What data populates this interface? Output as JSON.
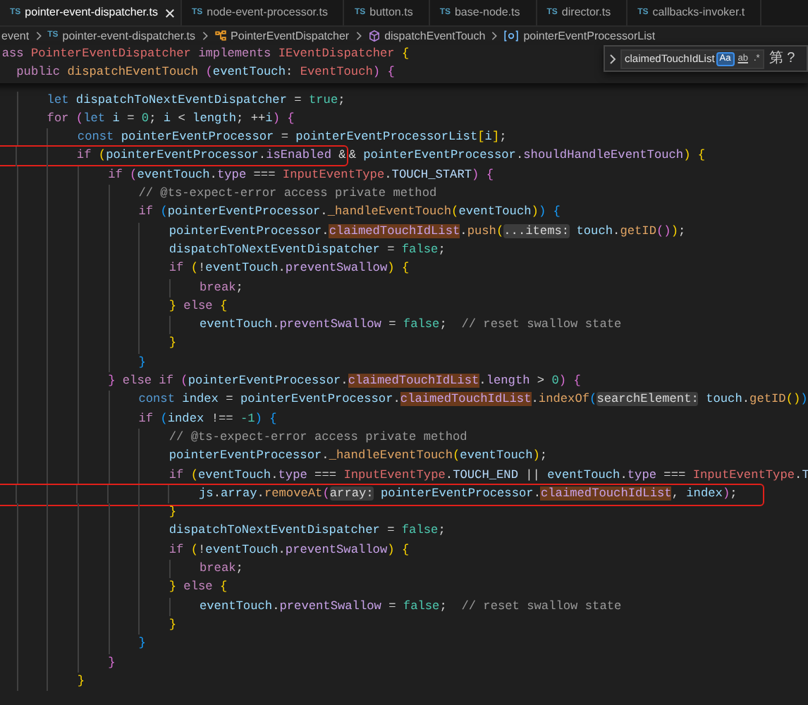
{
  "tabs": [
    {
      "icon_text": "TS",
      "label": "pointer-event-dispatcher.ts",
      "selected": true
    },
    {
      "icon_text": "TS",
      "label": "node-event-processor.ts",
      "selected": false
    },
    {
      "icon_text": "TS",
      "label": "button.ts",
      "selected": false
    },
    {
      "icon_text": "TS",
      "label": "base-node.ts",
      "selected": false
    },
    {
      "icon_text": "TS",
      "label": "director.ts",
      "selected": false
    },
    {
      "icon_text": "TS",
      "label": "callbacks-invoker.t",
      "selected": false
    }
  ],
  "breadcrumbs": [
    {
      "kind": "folder",
      "label": "event"
    },
    {
      "kind": "file",
      "icon_text": "TS",
      "label": "pointer-event-dispatcher.ts"
    },
    {
      "kind": "class",
      "label": "PointerEventDispatcher"
    },
    {
      "kind": "method",
      "label": "dispatchEventTouch"
    },
    {
      "kind": "field",
      "label": "pointerEventProcessorList"
    }
  ],
  "find_widget": {
    "value": "claimedTouchIdList",
    "options": [
      {
        "label": "Aa",
        "selected": true
      },
      {
        "label": "ab",
        "selected": false
      },
      {
        "label": ".*",
        "selected": false
      }
    ],
    "result": "第 ?"
  },
  "sticky_lines": [
    [
      {
        "kind": "k",
        "text": "  ass "
      },
      {
        "kind": "t",
        "text": "PointerEventDispatcher "
      },
      {
        "kind": "k",
        "text": "implements "
      },
      {
        "kind": "t",
        "text": "IEventDispatcher "
      },
      {
        "kind": "y",
        "text": "{"
      }
    ],
    [
      {
        "kind": "k",
        "text": "    public "
      },
      {
        "kind": "f",
        "text": "dispatchEventTouch "
      },
      {
        "kind": "m",
        "text": "("
      },
      {
        "kind": "v",
        "text": "eventTouch"
      },
      {
        "kind": "o",
        "text": ": "
      },
      {
        "kind": "t",
        "text": "EventTouch"
      },
      {
        "kind": "m",
        "text": ")"
      },
      {
        "kind": "m",
        "text": " {"
      }
    ]
  ],
  "code_lines": [
    [
      {
        "kind": "d",
        "text": "        let "
      },
      {
        "kind": "v",
        "text": "dispatchToNextEventDispatcher"
      },
      {
        "kind": "o",
        "text": " = "
      },
      {
        "kind": "n",
        "text": "true"
      },
      {
        "kind": "o",
        "text": ";"
      }
    ],
    [
      {
        "kind": "k",
        "text": "        for "
      },
      {
        "kind": "m",
        "text": "("
      },
      {
        "kind": "d",
        "text": "let "
      },
      {
        "kind": "v",
        "text": "i"
      },
      {
        "kind": "o",
        "text": " = "
      },
      {
        "kind": "n",
        "text": "0"
      },
      {
        "kind": "o",
        "text": "; "
      },
      {
        "kind": "v",
        "text": "i"
      },
      {
        "kind": "o",
        "text": " < "
      },
      {
        "kind": "v",
        "text": "length"
      },
      {
        "kind": "o",
        "text": "; ++"
      },
      {
        "kind": "v",
        "text": "i"
      },
      {
        "kind": "m",
        "text": ")"
      },
      {
        "kind": "m",
        "text": " {"
      }
    ],
    [
      {
        "kind": "d",
        "text": "            const "
      },
      {
        "kind": "v",
        "text": "pointerEventProcessor"
      },
      {
        "kind": "o",
        "text": " = "
      },
      {
        "kind": "v",
        "text": "pointerEventProcessorList"
      },
      {
        "kind": "y",
        "text": "["
      },
      {
        "kind": "v",
        "text": "i"
      },
      {
        "kind": "y",
        "text": "]"
      },
      {
        "kind": "o",
        "text": ";"
      }
    ],
    [
      {
        "kind": "box",
        "tokens": [
          {
            "kind": "k",
            "text": "            if "
          },
          {
            "kind": "y",
            "text": "("
          },
          {
            "kind": "v",
            "text": "pointerEventProcessor"
          },
          {
            "kind": "o",
            "text": "."
          },
          {
            "kind": "p",
            "text": "isEnabled"
          },
          {
            "kind": "o",
            "text": " &"
          }
        ]
      },
      {
        "kind": "o",
        "text": "& "
      },
      {
        "kind": "v",
        "text": "pointerEventProcessor"
      },
      {
        "kind": "o",
        "text": "."
      },
      {
        "kind": "p",
        "text": "shouldHandleEventTouch"
      },
      {
        "kind": "y",
        "text": ")"
      },
      {
        "kind": "y",
        "text": " {"
      }
    ],
    [
      {
        "kind": "k",
        "text": "                if "
      },
      {
        "kind": "m",
        "text": "("
      },
      {
        "kind": "v",
        "text": "eventTouch"
      },
      {
        "kind": "o",
        "text": "."
      },
      {
        "kind": "p",
        "text": "type"
      },
      {
        "kind": "o",
        "text": " === "
      },
      {
        "kind": "t",
        "text": "InputEventType"
      },
      {
        "kind": "o",
        "text": "."
      },
      {
        "kind": "e",
        "text": "TOUCH_START"
      },
      {
        "kind": "m",
        "text": ")"
      },
      {
        "kind": "m",
        "text": " {"
      }
    ],
    [
      {
        "kind": "c",
        "text": "                    // @ts-expect-error access private method"
      }
    ],
    [
      {
        "kind": "k",
        "text": "                    if "
      },
      {
        "kind": "u",
        "text": "("
      },
      {
        "kind": "v",
        "text": "pointerEventProcessor"
      },
      {
        "kind": "o",
        "text": "."
      },
      {
        "kind": "f",
        "text": "_handleEventTouch"
      },
      {
        "kind": "y",
        "text": "("
      },
      {
        "kind": "v",
        "text": "eventTouch"
      },
      {
        "kind": "y",
        "text": ")"
      },
      {
        "kind": "u",
        "text": ")"
      },
      {
        "kind": "u",
        "text": " {"
      }
    ],
    [
      {
        "kind": "v",
        "text": "                        pointerEventProcessor"
      },
      {
        "kind": "o",
        "text": "."
      },
      {
        "kind": "hl",
        "text": "claimedTouchIdList"
      },
      {
        "kind": "o",
        "text": "."
      },
      {
        "kind": "f",
        "text": "push"
      },
      {
        "kind": "y",
        "text": "("
      },
      {
        "kind": "h",
        "text": "...items:"
      },
      {
        "kind": "v",
        "text": " touch"
      },
      {
        "kind": "o",
        "text": "."
      },
      {
        "kind": "f",
        "text": "getID"
      },
      {
        "kind": "m",
        "text": "()"
      },
      {
        "kind": "y",
        "text": ")"
      },
      {
        "kind": "o",
        "text": ";"
      }
    ],
    [
      {
        "kind": "v",
        "text": "                        dispatchToNextEventDispatcher"
      },
      {
        "kind": "o",
        "text": " = "
      },
      {
        "kind": "n",
        "text": "false"
      },
      {
        "kind": "o",
        "text": ";"
      }
    ],
    [
      {
        "kind": "k",
        "text": "                        if "
      },
      {
        "kind": "y",
        "text": "("
      },
      {
        "kind": "o",
        "text": "!"
      },
      {
        "kind": "v",
        "text": "eventTouch"
      },
      {
        "kind": "o",
        "text": "."
      },
      {
        "kind": "p",
        "text": "preventSwallow"
      },
      {
        "kind": "y",
        "text": ")"
      },
      {
        "kind": "y",
        "text": " {"
      }
    ],
    [
      {
        "kind": "k",
        "text": "                            break"
      },
      {
        "kind": "o",
        "text": ";"
      }
    ],
    [
      {
        "kind": "y",
        "text": "                        }"
      },
      {
        "kind": "k",
        "text": " else "
      },
      {
        "kind": "y",
        "text": "{"
      }
    ],
    [
      {
        "kind": "v",
        "text": "                            eventTouch"
      },
      {
        "kind": "o",
        "text": "."
      },
      {
        "kind": "p",
        "text": "preventSwallow"
      },
      {
        "kind": "o",
        "text": " = "
      },
      {
        "kind": "n",
        "text": "false"
      },
      {
        "kind": "o",
        "text": ";"
      },
      {
        "kind": "c",
        "text": "  // reset swallow state"
      }
    ],
    [
      {
        "kind": "y",
        "text": "                        }"
      }
    ],
    [
      {
        "kind": "u",
        "text": "                    }"
      }
    ],
    [
      {
        "kind": "m",
        "text": "                }"
      },
      {
        "kind": "k",
        "text": " else if "
      },
      {
        "kind": "m",
        "text": "("
      },
      {
        "kind": "v",
        "text": "pointerEventProcessor"
      },
      {
        "kind": "o",
        "text": "."
      },
      {
        "kind": "hl",
        "text": "claimedTouchIdList"
      },
      {
        "kind": "o",
        "text": "."
      },
      {
        "kind": "p",
        "text": "length"
      },
      {
        "kind": "o",
        "text": " > "
      },
      {
        "kind": "n",
        "text": "0"
      },
      {
        "kind": "m",
        "text": ")"
      },
      {
        "kind": "m",
        "text": " {"
      }
    ],
    [
      {
        "kind": "d",
        "text": "                    const "
      },
      {
        "kind": "v",
        "text": "index"
      },
      {
        "kind": "o",
        "text": " = "
      },
      {
        "kind": "v",
        "text": "pointerEventProcessor"
      },
      {
        "kind": "o",
        "text": "."
      },
      {
        "kind": "hl",
        "text": "claimedTouchIdList"
      },
      {
        "kind": "o",
        "text": "."
      },
      {
        "kind": "f",
        "text": "indexOf"
      },
      {
        "kind": "u",
        "text": "("
      },
      {
        "kind": "h",
        "text": "searchElement:"
      },
      {
        "kind": "v",
        "text": " touch"
      },
      {
        "kind": "o",
        "text": "."
      },
      {
        "kind": "f",
        "text": "getID"
      },
      {
        "kind": "y",
        "text": "()"
      },
      {
        "kind": "u",
        "text": ")"
      }
    ],
    [
      {
        "kind": "k",
        "text": "                    if "
      },
      {
        "kind": "u",
        "text": "("
      },
      {
        "kind": "v",
        "text": "index"
      },
      {
        "kind": "o",
        "text": " !== "
      },
      {
        "kind": "n",
        "text": "-1"
      },
      {
        "kind": "u",
        "text": ")"
      },
      {
        "kind": "u",
        "text": " {"
      }
    ],
    [
      {
        "kind": "c",
        "text": "                        // @ts-expect-error access private method"
      }
    ],
    [
      {
        "kind": "v",
        "text": "                        pointerEventProcessor"
      },
      {
        "kind": "o",
        "text": "."
      },
      {
        "kind": "f",
        "text": "_handleEventTouch"
      },
      {
        "kind": "y",
        "text": "("
      },
      {
        "kind": "v",
        "text": "eventTouch"
      },
      {
        "kind": "y",
        "text": ")"
      },
      {
        "kind": "o",
        "text": ";"
      }
    ],
    [
      {
        "kind": "k",
        "text": "                        if "
      },
      {
        "kind": "y",
        "text": "("
      },
      {
        "kind": "v",
        "text": "eventTouch"
      },
      {
        "kind": "o",
        "text": "."
      },
      {
        "kind": "p",
        "text": "type"
      },
      {
        "kind": "o",
        "text": " === "
      },
      {
        "kind": "t",
        "text": "InputEventType"
      },
      {
        "kind": "o",
        "text": "."
      },
      {
        "kind": "e",
        "text": "TOUCH_END"
      },
      {
        "kind": "o",
        "text": " || "
      },
      {
        "kind": "v",
        "text": "eventTouch"
      },
      {
        "kind": "o",
        "text": "."
      },
      {
        "kind": "p",
        "text": "type"
      },
      {
        "kind": "o",
        "text": " === "
      },
      {
        "kind": "t",
        "text": "InputEventType"
      },
      {
        "kind": "o",
        "text": "."
      },
      {
        "kind": "e",
        "text": "T"
      }
    ],
    [
      {
        "kind": "box",
        "tokens": [
          {
            "kind": "v",
            "text": "                            js"
          },
          {
            "kind": "o",
            "text": "."
          },
          {
            "kind": "v",
            "text": "array"
          },
          {
            "kind": "o",
            "text": "."
          },
          {
            "kind": "f",
            "text": "removeAt"
          },
          {
            "kind": "m",
            "text": "("
          },
          {
            "kind": "h",
            "text": "array:"
          },
          {
            "kind": "v",
            "text": " pointerEventProcessor"
          },
          {
            "kind": "o",
            "text": "."
          },
          {
            "kind": "hl",
            "text": "claimedTouchIdList"
          },
          {
            "kind": "o",
            "text": ", "
          },
          {
            "kind": "v",
            "text": "index"
          },
          {
            "kind": "m",
            "text": ")"
          },
          {
            "kind": "o",
            "text": ";"
          }
        ]
      }
    ],
    [
      {
        "kind": "y",
        "text": "                        }"
      }
    ],
    [
      {
        "kind": "v",
        "text": "                        dispatchToNextEventDispatcher"
      },
      {
        "kind": "o",
        "text": " = "
      },
      {
        "kind": "n",
        "text": "false"
      },
      {
        "kind": "o",
        "text": ";"
      }
    ],
    [
      {
        "kind": "k",
        "text": "                        if "
      },
      {
        "kind": "y",
        "text": "("
      },
      {
        "kind": "o",
        "text": "!"
      },
      {
        "kind": "v",
        "text": "eventTouch"
      },
      {
        "kind": "o",
        "text": "."
      },
      {
        "kind": "p",
        "text": "preventSwallow"
      },
      {
        "kind": "y",
        "text": ")"
      },
      {
        "kind": "y",
        "text": " {"
      }
    ],
    [
      {
        "kind": "k",
        "text": "                            break"
      },
      {
        "kind": "o",
        "text": ";"
      }
    ],
    [
      {
        "kind": "y",
        "text": "                        }"
      },
      {
        "kind": "k",
        "text": " else "
      },
      {
        "kind": "y",
        "text": "{"
      }
    ],
    [
      {
        "kind": "v",
        "text": "                            eventTouch"
      },
      {
        "kind": "o",
        "text": "."
      },
      {
        "kind": "p",
        "text": "preventSwallow"
      },
      {
        "kind": "o",
        "text": " = "
      },
      {
        "kind": "n",
        "text": "false"
      },
      {
        "kind": "o",
        "text": ";"
      },
      {
        "kind": "c",
        "text": "  // reset swallow state"
      }
    ],
    [
      {
        "kind": "y",
        "text": "                        }"
      }
    ],
    [
      {
        "kind": "u",
        "text": "                    }"
      }
    ],
    [
      {
        "kind": "m",
        "text": "                }"
      }
    ],
    [
      {
        "kind": "y",
        "text": "            }"
      }
    ]
  ]
}
